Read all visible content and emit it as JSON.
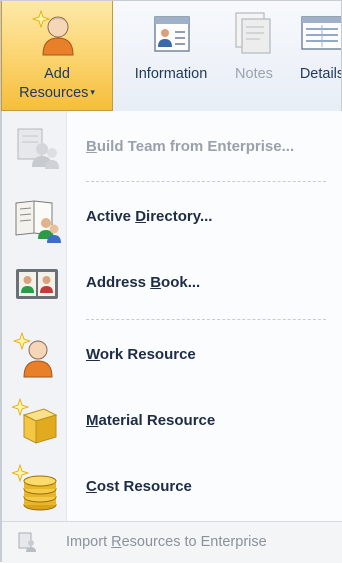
{
  "ribbon": {
    "add_resources": {
      "line1": "Add",
      "line2": "Resources",
      "caret": "▾",
      "icon": "person-sparkle-icon"
    },
    "information": {
      "label": "Information",
      "icon": "information-card-icon"
    },
    "notes": {
      "label": "Notes",
      "icon": "notes-icon"
    },
    "details": {
      "label": "Details",
      "icon": "details-icon"
    }
  },
  "menu": {
    "items": [
      {
        "pre": "",
        "key": "B",
        "post": "uild Team from Enterprise...",
        "icon": "team-enterprise-icon",
        "enabled": false
      },
      {
        "pre": "Active ",
        "key": "D",
        "post": "irectory...",
        "icon": "active-directory-icon",
        "enabled": true
      },
      {
        "pre": "Address ",
        "key": "B",
        "post": "ook...",
        "icon": "address-book-icon",
        "enabled": true
      },
      {
        "pre": "",
        "key": "W",
        "post": "ork Resource",
        "icon": "work-resource-icon",
        "enabled": true
      },
      {
        "pre": "",
        "key": "M",
        "post": "aterial Resource",
        "icon": "material-resource-icon",
        "enabled": true
      },
      {
        "pre": "",
        "key": "C",
        "post": "ost Resource",
        "icon": "cost-resource-icon",
        "enabled": true
      }
    ],
    "footer": {
      "pre": "Import ",
      "key": "R",
      "post": "esources to Enterprise",
      "icon": "import-resources-icon",
      "enabled": false
    }
  }
}
